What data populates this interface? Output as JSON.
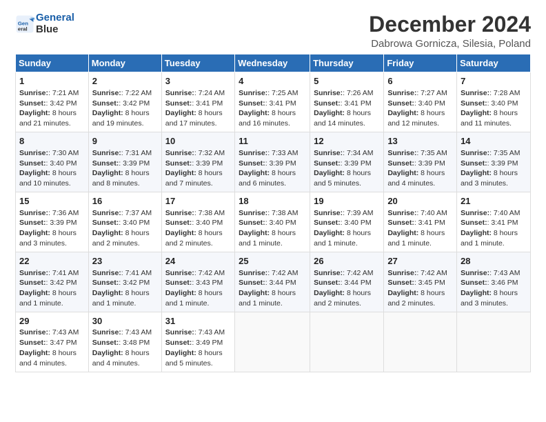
{
  "header": {
    "logo_line1": "General",
    "logo_line2": "Blue",
    "title": "December 2024",
    "subtitle": "Dabrowa Gornicza, Silesia, Poland"
  },
  "calendar": {
    "columns": [
      "Sunday",
      "Monday",
      "Tuesday",
      "Wednesday",
      "Thursday",
      "Friday",
      "Saturday"
    ],
    "weeks": [
      [
        {
          "day": "1",
          "info": "Sunrise: 7:21 AM\nSunset: 3:42 PM\nDaylight: 8 hours and 21 minutes."
        },
        {
          "day": "2",
          "info": "Sunrise: 7:22 AM\nSunset: 3:42 PM\nDaylight: 8 hours and 19 minutes."
        },
        {
          "day": "3",
          "info": "Sunrise: 7:24 AM\nSunset: 3:41 PM\nDaylight: 8 hours and 17 minutes."
        },
        {
          "day": "4",
          "info": "Sunrise: 7:25 AM\nSunset: 3:41 PM\nDaylight: 8 hours and 16 minutes."
        },
        {
          "day": "5",
          "info": "Sunrise: 7:26 AM\nSunset: 3:41 PM\nDaylight: 8 hours and 14 minutes."
        },
        {
          "day": "6",
          "info": "Sunrise: 7:27 AM\nSunset: 3:40 PM\nDaylight: 8 hours and 12 minutes."
        },
        {
          "day": "7",
          "info": "Sunrise: 7:28 AM\nSunset: 3:40 PM\nDaylight: 8 hours and 11 minutes."
        }
      ],
      [
        {
          "day": "8",
          "info": "Sunrise: 7:30 AM\nSunset: 3:40 PM\nDaylight: 8 hours and 10 minutes."
        },
        {
          "day": "9",
          "info": "Sunrise: 7:31 AM\nSunset: 3:39 PM\nDaylight: 8 hours and 8 minutes."
        },
        {
          "day": "10",
          "info": "Sunrise: 7:32 AM\nSunset: 3:39 PM\nDaylight: 8 hours and 7 minutes."
        },
        {
          "day": "11",
          "info": "Sunrise: 7:33 AM\nSunset: 3:39 PM\nDaylight: 8 hours and 6 minutes."
        },
        {
          "day": "12",
          "info": "Sunrise: 7:34 AM\nSunset: 3:39 PM\nDaylight: 8 hours and 5 minutes."
        },
        {
          "day": "13",
          "info": "Sunrise: 7:35 AM\nSunset: 3:39 PM\nDaylight: 8 hours and 4 minutes."
        },
        {
          "day": "14",
          "info": "Sunrise: 7:35 AM\nSunset: 3:39 PM\nDaylight: 8 hours and 3 minutes."
        }
      ],
      [
        {
          "day": "15",
          "info": "Sunrise: 7:36 AM\nSunset: 3:39 PM\nDaylight: 8 hours and 3 minutes."
        },
        {
          "day": "16",
          "info": "Sunrise: 7:37 AM\nSunset: 3:40 PM\nDaylight: 8 hours and 2 minutes."
        },
        {
          "day": "17",
          "info": "Sunrise: 7:38 AM\nSunset: 3:40 PM\nDaylight: 8 hours and 2 minutes."
        },
        {
          "day": "18",
          "info": "Sunrise: 7:38 AM\nSunset: 3:40 PM\nDaylight: 8 hours and 1 minute."
        },
        {
          "day": "19",
          "info": "Sunrise: 7:39 AM\nSunset: 3:40 PM\nDaylight: 8 hours and 1 minute."
        },
        {
          "day": "20",
          "info": "Sunrise: 7:40 AM\nSunset: 3:41 PM\nDaylight: 8 hours and 1 minute."
        },
        {
          "day": "21",
          "info": "Sunrise: 7:40 AM\nSunset: 3:41 PM\nDaylight: 8 hours and 1 minute."
        }
      ],
      [
        {
          "day": "22",
          "info": "Sunrise: 7:41 AM\nSunset: 3:42 PM\nDaylight: 8 hours and 1 minute."
        },
        {
          "day": "23",
          "info": "Sunrise: 7:41 AM\nSunset: 3:42 PM\nDaylight: 8 hours and 1 minute."
        },
        {
          "day": "24",
          "info": "Sunrise: 7:42 AM\nSunset: 3:43 PM\nDaylight: 8 hours and 1 minute."
        },
        {
          "day": "25",
          "info": "Sunrise: 7:42 AM\nSunset: 3:44 PM\nDaylight: 8 hours and 1 minute."
        },
        {
          "day": "26",
          "info": "Sunrise: 7:42 AM\nSunset: 3:44 PM\nDaylight: 8 hours and 2 minutes."
        },
        {
          "day": "27",
          "info": "Sunrise: 7:42 AM\nSunset: 3:45 PM\nDaylight: 8 hours and 2 minutes."
        },
        {
          "day": "28",
          "info": "Sunrise: 7:43 AM\nSunset: 3:46 PM\nDaylight: 8 hours and 3 minutes."
        }
      ],
      [
        {
          "day": "29",
          "info": "Sunrise: 7:43 AM\nSunset: 3:47 PM\nDaylight: 8 hours and 4 minutes."
        },
        {
          "day": "30",
          "info": "Sunrise: 7:43 AM\nSunset: 3:48 PM\nDaylight: 8 hours and 4 minutes."
        },
        {
          "day": "31",
          "info": "Sunrise: 7:43 AM\nSunset: 3:49 PM\nDaylight: 8 hours and 5 minutes."
        },
        null,
        null,
        null,
        null
      ]
    ]
  }
}
